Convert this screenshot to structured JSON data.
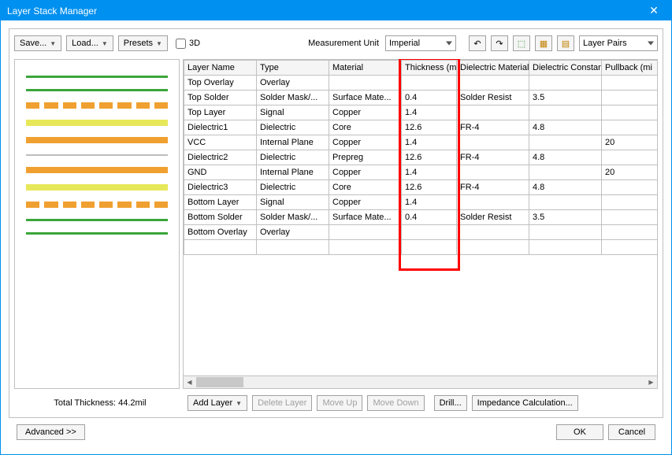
{
  "window": {
    "title": "Layer Stack Manager"
  },
  "toolbar": {
    "save": "Save...",
    "load": "Load...",
    "presets": "Presets",
    "threeD": "3D",
    "measurement_label": "Measurement Unit",
    "measurement_value": "Imperial",
    "layer_mode": "Layer Pairs"
  },
  "preview": {
    "colors": {
      "green": "#3aa63a",
      "yellow": "#e7e75a",
      "orange": "#f0a030",
      "grey": "#bdbdbd"
    }
  },
  "table": {
    "headers": [
      "Layer Name",
      "Type",
      "Material",
      "Thickness (mil)",
      "Dielectric Material",
      "Dielectric Constant",
      "Pullback (mi"
    ],
    "rows": [
      {
        "name": "Top Overlay",
        "type": "Overlay",
        "material": "",
        "thickness": "",
        "diel_mat": "",
        "diel_const": "",
        "pullback": ""
      },
      {
        "name": "Top Solder",
        "type": "Solder Mask/...",
        "material": "Surface Mate...",
        "thickness": "0.4",
        "diel_mat": "Solder Resist",
        "diel_const": "3.5",
        "pullback": ""
      },
      {
        "name": "Top Layer",
        "type": "Signal",
        "material": "Copper",
        "thickness": "1.4",
        "diel_mat": "",
        "diel_const": "",
        "pullback": ""
      },
      {
        "name": "Dielectric1",
        "type": "Dielectric",
        "material": "Core",
        "thickness": "12.6",
        "diel_mat": "FR-4",
        "diel_const": "4.8",
        "pullback": ""
      },
      {
        "name": "VCC",
        "type": "Internal Plane",
        "material": "Copper",
        "thickness": "1.4",
        "diel_mat": "",
        "diel_const": "",
        "pullback": "20"
      },
      {
        "name": "Dielectric2",
        "type": "Dielectric",
        "material": "Prepreg",
        "thickness": "12.6",
        "diel_mat": "FR-4",
        "diel_const": "4.8",
        "pullback": ""
      },
      {
        "name": "GND",
        "type": "Internal Plane",
        "material": "Copper",
        "thickness": "1.4",
        "diel_mat": "",
        "diel_const": "",
        "pullback": "20"
      },
      {
        "name": "Dielectric3",
        "type": "Dielectric",
        "material": "Core",
        "thickness": "12.6",
        "diel_mat": "FR-4",
        "diel_const": "4.8",
        "pullback": ""
      },
      {
        "name": "Bottom Layer",
        "type": "Signal",
        "material": "Copper",
        "thickness": "1.4",
        "diel_mat": "",
        "diel_const": "",
        "pullback": ""
      },
      {
        "name": "Bottom Solder",
        "type": "Solder Mask/...",
        "material": "Surface Mate...",
        "thickness": "0.4",
        "diel_mat": "Solder Resist",
        "diel_const": "3.5",
        "pullback": ""
      },
      {
        "name": "Bottom Overlay",
        "type": "Overlay",
        "material": "",
        "thickness": "",
        "diel_mat": "",
        "diel_const": "",
        "pullback": ""
      }
    ]
  },
  "bottom": {
    "total_thickness": "Total Thickness: 44.2mil",
    "add_layer": "Add Layer",
    "delete_layer": "Delete Layer",
    "move_up": "Move Up",
    "move_down": "Move Down",
    "drill": "Drill...",
    "impedance": "Impedance Calculation..."
  },
  "footer": {
    "advanced": "Advanced >>",
    "ok": "OK",
    "cancel": "Cancel"
  }
}
